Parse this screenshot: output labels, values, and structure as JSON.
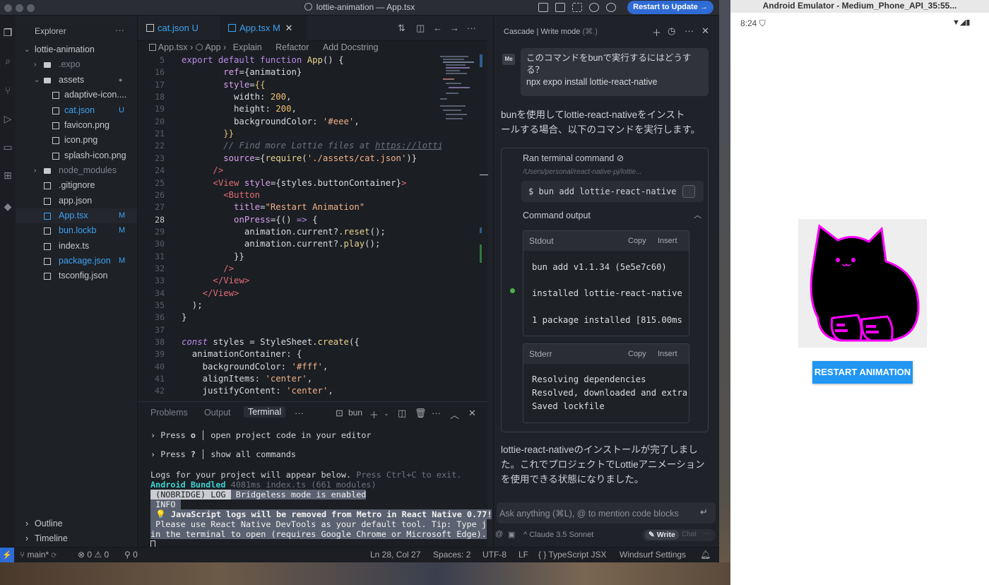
{
  "window": {
    "title": "lottie-animation — App.tsx",
    "update_button": "Restart to Update →",
    "notification_count": "1"
  },
  "explorer": {
    "title": "Explorer",
    "more": "···",
    "root": "lottie-animation",
    "items": [
      {
        "name": ".expo",
        "badge": ""
      },
      {
        "name": "assets",
        "badge": "●"
      },
      {
        "name": "adaptive-icon....",
        "badge": ""
      },
      {
        "name": "cat.json",
        "badge": "U"
      },
      {
        "name": "favicon.png",
        "badge": ""
      },
      {
        "name": "icon.png",
        "badge": ""
      },
      {
        "name": "splash-icon.png",
        "badge": ""
      },
      {
        "name": "node_modules",
        "badge": ""
      },
      {
        "name": ".gitignore",
        "badge": ""
      },
      {
        "name": "app.json",
        "badge": ""
      },
      {
        "name": "App.tsx",
        "badge": "M"
      },
      {
        "name": "bun.lockb",
        "badge": "M"
      },
      {
        "name": "index.ts",
        "badge": ""
      },
      {
        "name": "package.json",
        "badge": "M"
      },
      {
        "name": "tsconfig.json",
        "badge": ""
      }
    ],
    "outline": "Outline",
    "timeline": "Timeline"
  },
  "editor": {
    "tabs": [
      {
        "label": "cat.json",
        "badge": "U"
      },
      {
        "label": "App.tsx",
        "badge": "M"
      }
    ],
    "close": "✕",
    "breadcrumb": {
      "file": "App.tsx",
      "symbol": "App",
      "actions": [
        "Explain",
        "Refactor",
        "Add Docstring"
      ]
    },
    "line_numbers": [
      "5",
      "16",
      "17",
      "18",
      "19",
      "20",
      "21",
      "22",
      "23",
      "24",
      "25",
      "26",
      "27",
      "28",
      "29",
      "30",
      "31",
      "32",
      "33",
      "34",
      "35",
      "36",
      "37",
      "38",
      "39",
      "40",
      "41",
      "42"
    ]
  },
  "panel": {
    "tabs": [
      "Problems",
      "Output",
      "Terminal"
    ],
    "shell": "bun",
    "lines": {
      "l1a": "› Press ",
      "l1b": "o",
      "l1c": " │ open project code in your editor",
      "l2a": "› Press ",
      "l2b": "?",
      "l2c": " │ show all commands",
      "l3a": "Logs for your project will appear below. ",
      "l3b": "Press Ctrl+C to exit.",
      "l4a": "Android Bundled ",
      "l4b": "4081ms index.ts (661 modules)",
      "l5a": " (NOBRIDGE) LOG ",
      "l5b": " Bridgeless mode is enabled",
      "l6": " INFO ",
      "l7": " 💡 JavaScript logs will be removed from Metro in React Native 0.77!",
      "l8": " Please use React Native DevTools as your default tool. Tip: Type j",
      "l9": "in the terminal to open (requires Google Chrome or Microsoft Edge)."
    }
  },
  "statusbar": {
    "branch": "main*",
    "problems": "⊗ 0 ⚠ 0",
    "ports": "0",
    "position": "Ln 28, Col 27",
    "spaces": "Spaces: 2",
    "encoding": "UTF-8",
    "eol": "LF",
    "language": "{ } TypeScript JSX",
    "settings": "Windsurf Settings"
  },
  "cascade": {
    "title": "Cascade | Write mode",
    "title_hint": "(⌘.)",
    "me": "Me",
    "user_message_l1": "このコマンドをbunで実行するにはどうす",
    "user_message_l2": "る？",
    "user_message_l3": "npx expo install lottie-react-native",
    "reply_1a": "bunを使用してlottie-react-nativeをインスト",
    "reply_1b": "ールする場合、以下のコマンドを実行します。",
    "ran_title": "Ran terminal command ⊘",
    "ran_path": "/Users/personal/react-native-pj/lottie...",
    "command": "$ bun add lottie-react-native",
    "output_title": "Command output",
    "stdout_label": "Stdout",
    "stderr_label": "Stderr",
    "copy": "Copy",
    "insert": "Insert",
    "stdout_lines": [
      "bun add v1.1.34 (5e5e7c60)",
      "installed lottie-react-native",
      "1 package installed [815.00ms"
    ],
    "stderr_lines": [
      "Resolving dependencies",
      "Resolved, downloaded and extra",
      "Saved lockfile"
    ],
    "reply_2a": "lottie-react-nativeのインストールが完了しまし",
    "reply_2b": "た。これでプロジェクトでLottieアニメーション",
    "reply_2c": "を使用できる状態になりました。",
    "ask_placeholder": "Ask anything (⌘L), @ to mention code blocks",
    "model": "^ Claude 3.5 Sonnet",
    "write_label": "Write",
    "chat_label": "Chat"
  },
  "emulator": {
    "title": "Android Emulator - Medium_Phone_API_35:55...",
    "time": "8:24",
    "restart_button": "RESTART ANIMATION"
  },
  "colors": {
    "accent": "#2f6bd4",
    "modified": "#3da3f5",
    "emulator_button": "#2196f3",
    "cat_outline": "#ff00ff"
  }
}
